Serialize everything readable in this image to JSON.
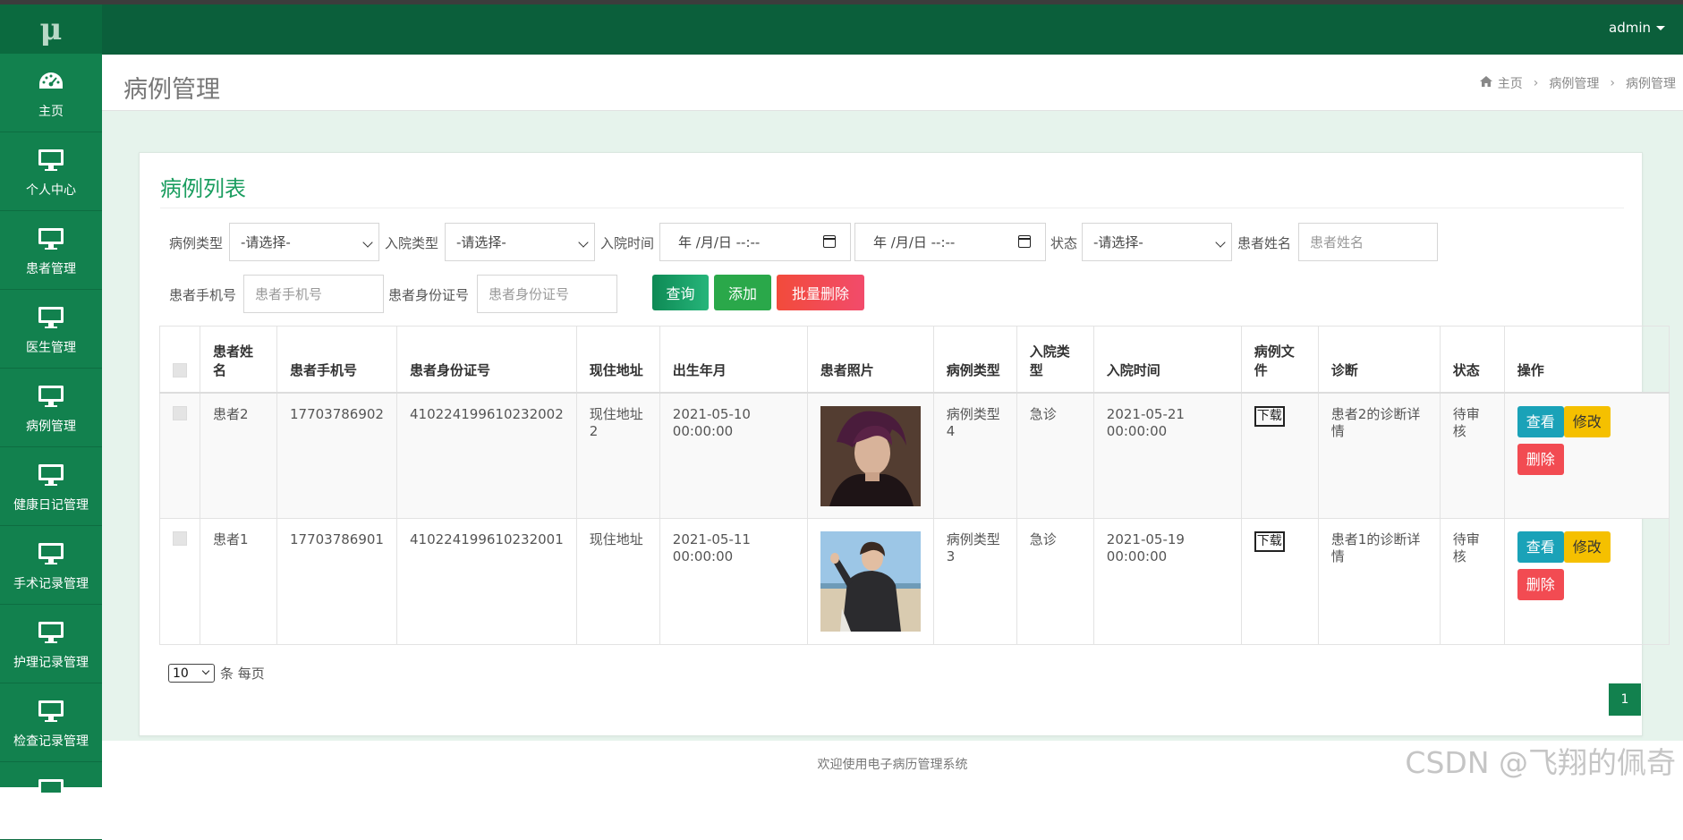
{
  "app": {
    "logo": "μ",
    "user": "admin"
  },
  "sidebar": {
    "items": [
      {
        "label": "主页",
        "icon": "dashboard-icon"
      },
      {
        "label": "个人中心",
        "icon": "monitor-icon"
      },
      {
        "label": "患者管理",
        "icon": "monitor-icon"
      },
      {
        "label": "医生管理",
        "icon": "monitor-icon"
      },
      {
        "label": "病例管理",
        "icon": "monitor-icon"
      },
      {
        "label": "健康日记管理",
        "icon": "monitor-icon"
      },
      {
        "label": "手术记录管理",
        "icon": "monitor-icon"
      },
      {
        "label": "护理记录管理",
        "icon": "monitor-icon"
      },
      {
        "label": "检查记录管理",
        "icon": "monitor-icon"
      },
      {
        "label": "",
        "icon": "monitor-icon"
      }
    ]
  },
  "header": {
    "title": "病例管理",
    "breadcrumb": [
      "主页",
      "病例管理",
      "病例管理"
    ]
  },
  "panel": {
    "title": "病例列表"
  },
  "filters": {
    "case_type_label": "病例类型",
    "case_type_value": "-请选择-",
    "admission_type_label": "入院类型",
    "admission_type_value": "-请选择-",
    "admission_time_label": "入院时间",
    "date_placeholder_1": "年 /月/日 --:--",
    "date_placeholder_2": "年 /月/日 --:--",
    "status_label": "状态",
    "status_value": "-请选择-",
    "patient_name_label": "患者姓名",
    "patient_name_placeholder": "患者姓名",
    "phone_label": "患者手机号",
    "phone_placeholder": "患者手机号",
    "id_label": "患者身份证号",
    "id_placeholder": "患者身份证号",
    "query_button": "查询",
    "add_button": "添加",
    "batch_delete_button": "批量删除"
  },
  "table": {
    "headers": [
      "患者姓名",
      "患者手机号",
      "患者身份证号",
      "现住地址",
      "出生年月",
      "患者照片",
      "病例类型",
      "入院类型",
      "入院时间",
      "病例文件",
      "诊断",
      "状态",
      "操作"
    ],
    "rows": [
      {
        "name": "患者2",
        "phone": "17703786902",
        "id_number": "410224199610232002",
        "address": "现住地址2",
        "birth": "2021-05-10 00:00:00",
        "photo": "portrait-photo-dark-hair",
        "case_type": "病例类型4",
        "admission_type": "急诊",
        "admission_time": "2021-05-21 00:00:00",
        "file_button": "下载",
        "diagnosis": "患者2的诊断详情",
        "status": "待审核"
      },
      {
        "name": "患者1",
        "phone": "17703786901",
        "id_number": "410224199610232001",
        "address": "现住地址",
        "birth": "2021-05-11 00:00:00",
        "photo": "outdoor-photo-beach",
        "case_type": "病例类型3",
        "admission_type": "急诊",
        "admission_time": "2021-05-19 00:00:00",
        "file_button": "下载",
        "diagnosis": "患者1的诊断详情",
        "status": "待审核"
      }
    ],
    "actions": {
      "view": "查看",
      "edit": "修改",
      "delete": "删除"
    }
  },
  "pagination": {
    "page_size": "10",
    "page_size_suffix": "条 每页",
    "current_page": "1"
  },
  "footer": {
    "text": "欢迎使用电子病历管理系统"
  },
  "watermark": "CSDN @飞翔的佩奇",
  "colors": {
    "sidebar": "#12814e",
    "topbar": "#0b5f3b",
    "accent": "#1a9d5f"
  }
}
